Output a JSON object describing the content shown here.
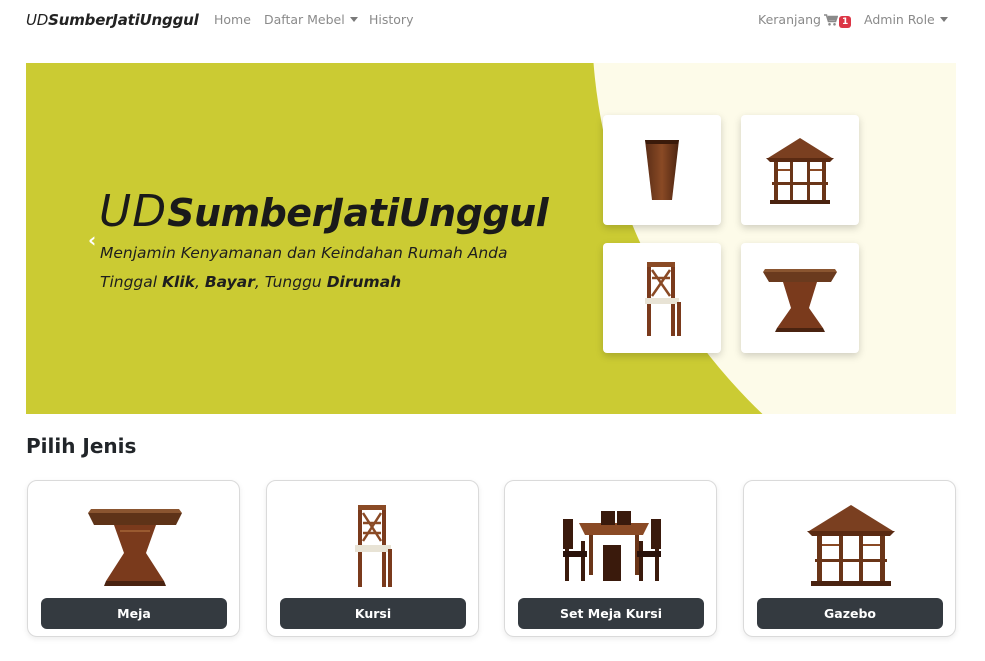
{
  "navbar": {
    "brand_light": "UD",
    "brand_bold": "SumberJatiUnggul",
    "home": "Home",
    "daftar_mebel": "Daftar Mebel",
    "history": "History",
    "cart_label": "Keranjang",
    "cart_count": "1",
    "admin": "Admin Role"
  },
  "hero": {
    "logo_light": "UD",
    "logo_bold": "SumberJatiUnggul",
    "line1": "Menjamin Kenyamanan dan Keindahan Rumah Anda",
    "line2_a": "Tinggal ",
    "line2_b": "Klik",
    "line2_c": ", ",
    "line2_d": "Bayar",
    "line2_e": ", Tunggu ",
    "line2_f": "Dirumah",
    "prev_arrow": "‹",
    "colors": {
      "background": "#cbcb33",
      "blob": "#fdfbe9"
    }
  },
  "section": {
    "title": "Pilih Jenis",
    "cards": [
      {
        "label": "Meja",
        "icon": "table-icon"
      },
      {
        "label": "Kursi",
        "icon": "chair-icon"
      },
      {
        "label": "Set Meja Kursi",
        "icon": "dining-set-icon"
      },
      {
        "label": "Gazebo",
        "icon": "gazebo-icon"
      }
    ]
  },
  "colors": {
    "button": "#343a40",
    "badge": "#dc3545",
    "nav_text": "#8a8a8a"
  }
}
